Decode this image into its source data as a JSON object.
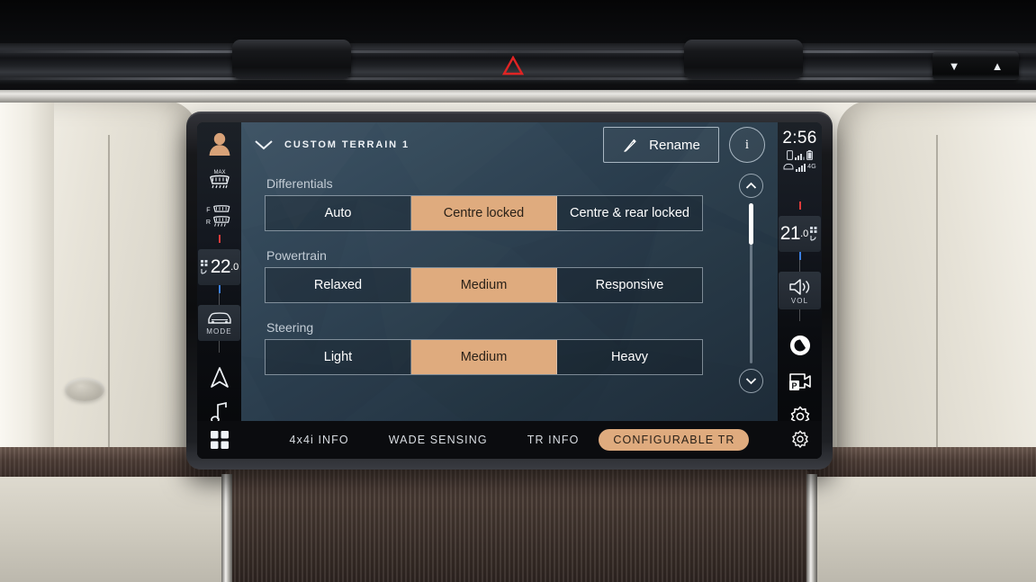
{
  "vehicle_ui": {
    "header": {
      "chevron_icon": "chevron-down-icon",
      "title": "CUSTOM TERRAIN 1",
      "rename_label": "Rename",
      "rename_icon": "pencil-icon",
      "info_label": "i"
    },
    "groups": [
      {
        "label": "Differentials",
        "options": [
          "Auto",
          "Centre locked",
          "Centre & rear locked"
        ],
        "selected_index": 1
      },
      {
        "label": "Powertrain",
        "options": [
          "Relaxed",
          "Medium",
          "Responsive"
        ],
        "selected_index": 1
      },
      {
        "label": "Steering",
        "options": [
          "Light",
          "Medium",
          "Heavy"
        ],
        "selected_index": 1
      }
    ],
    "scroll": {
      "up_icon": "chevron-up-icon",
      "down_icon": "chevron-down-icon"
    },
    "tabs": [
      {
        "label": "4x4i INFO",
        "active": false
      },
      {
        "label": "WADE SENSING",
        "active": false
      },
      {
        "label": "TR INFO",
        "active": false
      },
      {
        "label": "CONFIGURABLE TR",
        "active": true
      }
    ],
    "left_rail": {
      "avatar_icon": "user-avatar-icon",
      "max_defrost_icon": "max-defrost-icon",
      "max_defrost_label": "MAX",
      "front_defrost_label": "F",
      "rear_defrost_label": "R",
      "temperature": "22",
      "temperature_decimal": ".0",
      "mode_label": "MODE",
      "mode_icon": "car-front-icon",
      "navigation_icon": "navigation-arrow-icon",
      "media_icon": "music-note-icon",
      "apps_icon": "apps-grid-icon"
    },
    "right_rail": {
      "clock": "2:56",
      "status": {
        "phone_icon": "phone-icon",
        "phone_signal_icon": "signal-bars-icon",
        "battery_icon": "battery-icon",
        "modem_icon": "car-modem-icon",
        "modem_signal_icon": "signal-bars-icon",
        "network_label": "4G"
      },
      "temperature": "21",
      "temperature_decimal": ".0",
      "fan_icon": "fan-icon",
      "volume_label": "VOL",
      "volume_icon": "speaker-icon",
      "voice_icon": "voice-assistant-icon",
      "parking_camera_icon": "parking-camera-icon",
      "settings_icon": "gear-icon"
    }
  },
  "dashboard": {
    "hazard_icon": "hazard-triangle-icon",
    "hazard_color": "#e02020",
    "pod_down_icon": "chevron-down-icon",
    "pod_down_label": "⌄",
    "pod_up_label": "⌃"
  },
  "theme": {
    "accent_tan": "#dfab7e",
    "screen_blue": "#2b3e4e",
    "rail_dark": "#0b0d11",
    "text_light": "#ffffff"
  }
}
